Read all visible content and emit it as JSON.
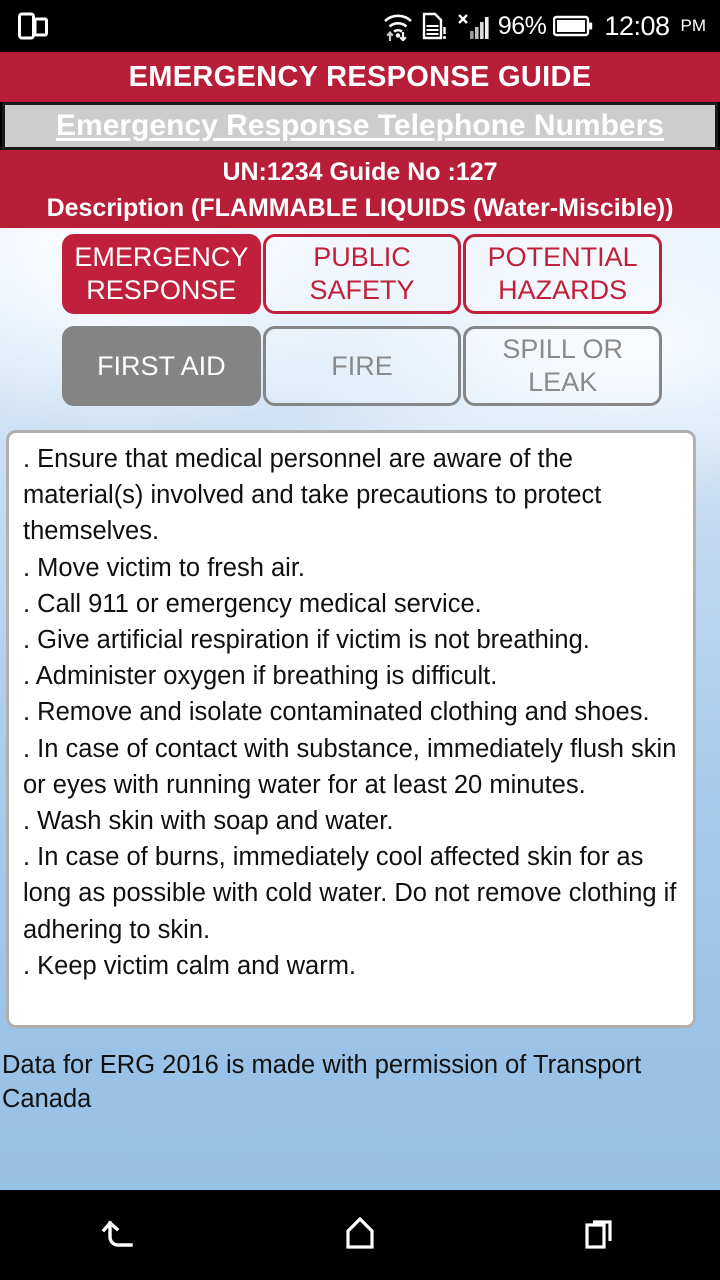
{
  "status_bar": {
    "left_icon": "dual-screen-cast-icon",
    "icons": [
      "wifi-icon",
      "sd-card-warning-icon",
      "signal-no-sim-icon"
    ],
    "battery_percent": "96%",
    "battery_icon": "battery-icon",
    "time": "12:08",
    "meridiem": "PM"
  },
  "header": {
    "title": "EMERGENCY RESPONSE GUIDE",
    "phone_numbers_link": "Emergency Response Telephone Numbers",
    "un_line": "UN:1234 Guide No :127",
    "description_line": "Description (FLAMMABLE LIQUIDS  (Water-Miscible))"
  },
  "buttons": {
    "row1": [
      {
        "label_line1": "EMERGENCY",
        "label_line2": "RESPONSE",
        "state": "active",
        "theme": "red"
      },
      {
        "label_line1": "PUBLIC",
        "label_line2": "SAFETY",
        "state": "idle",
        "theme": "red"
      },
      {
        "label_line1": "POTENTIAL",
        "label_line2": "HAZARDS",
        "state": "idle",
        "theme": "red"
      }
    ],
    "row2": [
      {
        "label_line1": "FIRST AID",
        "label_line2": "",
        "state": "active",
        "theme": "gray"
      },
      {
        "label_line1": "FIRE",
        "label_line2": "",
        "state": "idle",
        "theme": "gray"
      },
      {
        "label_line1": "SPILL OR LEAK",
        "label_line2": "",
        "state": "idle",
        "theme": "gray"
      }
    ]
  },
  "content": {
    "items": [
      ".  Ensure that medical personnel are aware of the material(s) involved and take precautions to protect themselves.",
      ".  Move victim to fresh air.",
      ".  Call 911 or emergency medical service.",
      ".  Give artificial respiration if victim is not breathing.",
      ".  Administer oxygen if breathing is difficult.",
      ".  Remove and isolate contaminated clothing and shoes.",
      ".  In case of contact with substance, immediately flush skin or eyes with running water for at least 20 minutes.",
      ".  Wash skin with soap and water.",
      ".  In case of burns, immediately cool affected skin for as long as possible with cold water.  Do not remove clothing if adhering to skin.",
      ".  Keep victim calm and warm."
    ]
  },
  "footer": {
    "note": "Data for ERG 2016 is made with permission of Transport Canada"
  },
  "nav_bar": {
    "back": "back-icon",
    "home": "home-icon",
    "recents": "recents-icon"
  },
  "colors": {
    "brand_red": "#b81e38",
    "button_red": "#c0203c",
    "button_gray": "#848484",
    "sky_top": "#e8f1fb",
    "sky_bottom": "#97c0e5"
  }
}
